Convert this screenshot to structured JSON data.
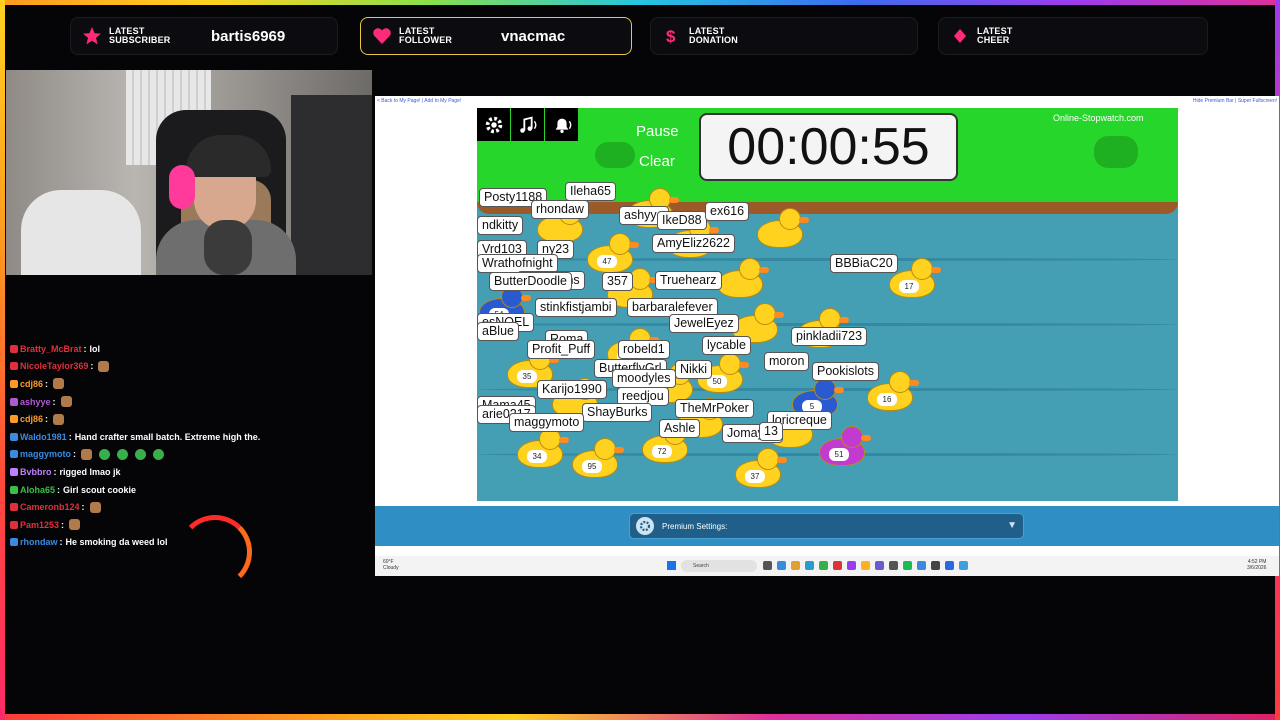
{
  "alerts": [
    {
      "label": "LATEST SUBSCRIBER",
      "value": "bartis6969",
      "icon": "star-icon",
      "active": false
    },
    {
      "label": "LATEST FOLLOWER",
      "value": "vnacmac",
      "icon": "heart-icon",
      "active": true
    },
    {
      "label": "LATEST DONATION",
      "value": "",
      "icon": "dollar-icon",
      "active": false
    },
    {
      "label": "LATEST CHEER",
      "value": "",
      "icon": "diamond-icon",
      "active": false
    }
  ],
  "chat": [
    {
      "user": "Bratty_McBrat",
      "color": "#e0303a",
      "message": "lol"
    },
    {
      "user": "NicoleTaylor369",
      "color": "#e0303a",
      "message": ""
    },
    {
      "user": "cdj86",
      "color": "#ff9a2a",
      "message": ""
    },
    {
      "user": "ashyye",
      "color": "#b05ad0",
      "message": ""
    },
    {
      "user": "cdj86",
      "color": "#ff9a2a",
      "message": ""
    },
    {
      "user": "Waldo1981",
      "color": "#3a8ae0",
      "message": "Hand crafter small batch. Extreme high the."
    },
    {
      "user": "maggymoto",
      "color": "#3a8ae0",
      "message": ""
    },
    {
      "user": "Bvbbro",
      "color": "#c080ff",
      "message": "rigged lmao jk"
    },
    {
      "user": "Aloha65",
      "color": "#38c048",
      "message": "Girl scout cookie"
    },
    {
      "user": "Cameronb124",
      "color": "#e0303a",
      "message": ""
    },
    {
      "user": "Pam1253",
      "color": "#e0303a",
      "message": ""
    },
    {
      "user": "rhondaw",
      "color": "#3a8ae0",
      "message": "He smoking da weed lol"
    }
  ],
  "browser": {
    "links_left": "< Back to My Page! | Add to My Page!",
    "links_right": "Hide Premium Bar | Super Fullscreen!"
  },
  "game": {
    "pause_label": "Pause",
    "clear_label": "Clear",
    "timer": "00:00:55",
    "brand": "Online-Stopwatch.com",
    "tools": [
      "gear-icon",
      "music-icon",
      "bell-icon"
    ],
    "names": [
      {
        "text": "Posty1188"
      },
      {
        "text": "Ileha65"
      },
      {
        "text": "rhondaw"
      },
      {
        "text": "ashyye"
      },
      {
        "text": "IkeD88"
      },
      {
        "text": "ex616"
      },
      {
        "text": "ndkitty"
      },
      {
        "text": "AmyEliz2622"
      },
      {
        "text": "Vrd103"
      },
      {
        "text": "ny23"
      },
      {
        "text": "Wrathofnight"
      },
      {
        "text": "BBBiaC20"
      },
      {
        "text": "SirCrowns"
      },
      {
        "text": "Truehearz"
      },
      {
        "text": "ButterDoodle"
      },
      {
        "text": "357"
      },
      {
        "text": "stinkfistjambi"
      },
      {
        "text": "barbaralefever"
      },
      {
        "text": "esNOEL"
      },
      {
        "text": "JewelEyez"
      },
      {
        "text": "aBlue"
      },
      {
        "text": "pinkladii723"
      },
      {
        "text": "Roma"
      },
      {
        "text": "lycable"
      },
      {
        "text": "Profit_Puff"
      },
      {
        "text": "robeld1"
      },
      {
        "text": "moron"
      },
      {
        "text": "ButterflyGrl"
      },
      {
        "text": "Nikki"
      },
      {
        "text": "Pookislots"
      },
      {
        "text": "moodyles"
      },
      {
        "text": "Karijo1990"
      },
      {
        "text": "reedjou"
      },
      {
        "text": "Mama45"
      },
      {
        "text": "TheMrPoker"
      },
      {
        "text": "arie0217"
      },
      {
        "text": "ShayBurks"
      },
      {
        "text": "loricreque"
      },
      {
        "text": "maggymoto"
      },
      {
        "text": "Ashle"
      },
      {
        "text": "Jomay89"
      },
      {
        "text": "13"
      }
    ],
    "duck_numbers": [
      "17",
      "47",
      "54",
      "35",
      "22",
      "50",
      "5",
      "16",
      "34",
      "95",
      "72",
      "37",
      "51"
    ]
  },
  "premium": {
    "label": "Premium Settings:"
  },
  "taskbar": {
    "weather_temp": "60°F",
    "weather_desc": "Cloudy",
    "search": "Search",
    "time": "4:52 PM",
    "date": "3/6/2026"
  }
}
